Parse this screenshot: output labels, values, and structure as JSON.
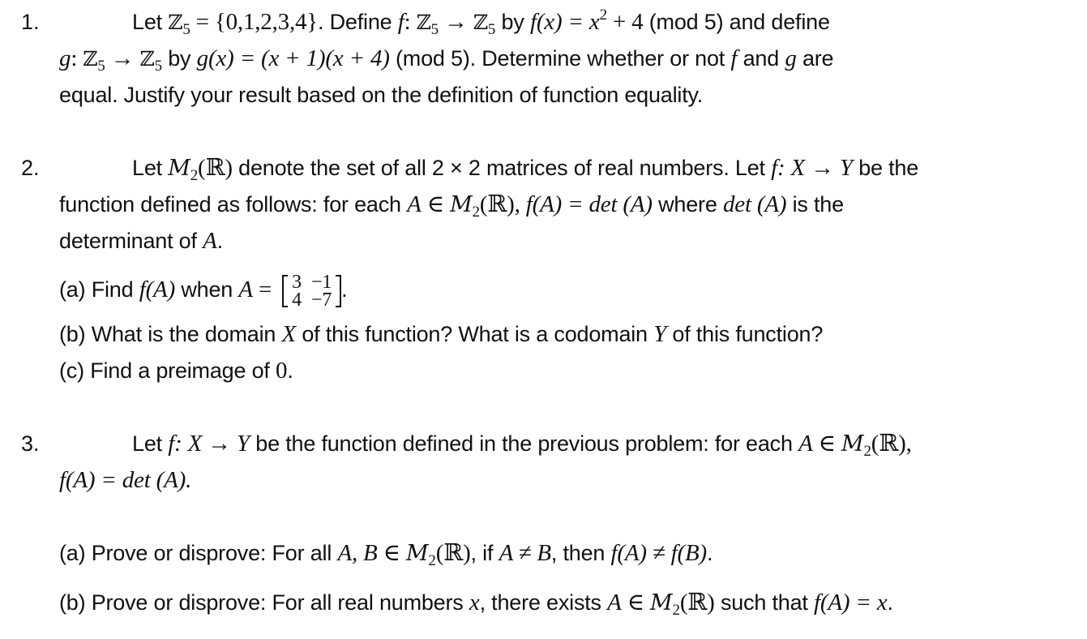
{
  "problems": [
    {
      "number": "1.",
      "z5": "ℤ",
      "sub5": "5",
      "set": " = {0,1,2,3,4}",
      "lines": {
        "l1_let": "Let ",
        "l1_define": ".  Define ",
        "l1_f": "f",
        "l1_colon": ": ",
        "l1_arrow": " → ",
        "l1_by": " by ",
        "l1_fx": "f",
        "l1_fx_rest": "(x) = x",
        "l1_sq": "2",
        "l1_plus4": " + 4",
        "l1_mod": " (mod 5) and define",
        "l2_g": "g",
        "l2_by": " by ",
        "l2_gx": "g",
        "l2_expr": "(x) = (x + 1)(x + 4)",
        "l2_mod": " (mod 5). Determine whether or not ",
        "l2_f": "f",
        "l2_and": " and ",
        "l2_g2": "g",
        "l2_are": " are",
        "l3": "equal.  Justify your result based on the definition of function equality."
      }
    },
    {
      "number": "2.",
      "lines": {
        "l1_let": "Let ",
        "l1_M": "M",
        "l1_sub": "2",
        "l1_R": "(ℝ)",
        "l1_text": " denote the set of all 2 × 2 matrices of real numbers. Let ",
        "l1_f": "f",
        "l1_map": ": X → Y",
        "l1_end": " be the",
        "l2_text": "function defined as follows: for each ",
        "l2_A": "A",
        "l2_in": " ∈ ",
        "l2_M": "M",
        "l2_sub": "2",
        "l2_R": "(ℝ), ",
        "l2_fA": "f",
        "l2_eq": "(A) = det (A)",
        "l2_where": " where ",
        "l2_det": "det (A)",
        "l2_isthe": " is the",
        "l3_text": "determinant of ",
        "l3_A": "A",
        "l3_dot": "."
      },
      "parts": [
        {
          "label": "(a)",
          "text_before": " Find ",
          "f": "f",
          "fA": "(A)",
          "when": " when ",
          "A": "A",
          "eq": " = ",
          "matrix": [
            [
              "3",
              "−1"
            ],
            [
              "4",
              "−7"
            ]
          ],
          "end": "."
        },
        {
          "label": "(b)",
          "text": " What is the domain ",
          "X": "X",
          "text2": " of this function?  What is a codomain ",
          "Y": "Y",
          "text3": " of this function?"
        },
        {
          "label": "(c)",
          "text": " Find a preimage of ",
          "zero": "0",
          "end": "."
        }
      ]
    },
    {
      "number": "3.",
      "lines": {
        "l1_let": "Let ",
        "l1_f": "f",
        "l1_map": ": X → Y",
        "l1_text": " be the function defined in the previous problem: for each ",
        "l1_A": "A",
        "l1_in": " ∈ ",
        "l1_M": "M",
        "l1_sub": "2",
        "l1_R": "(ℝ),",
        "l2_f": "f",
        "l2_eq": "(A) = det (A)."
      },
      "parts": [
        {
          "label": "(a)",
          "text": " Prove or disprove:  For all ",
          "AB": "A, B",
          "in": " ∈ ",
          "M": "M",
          "sub": "2",
          "R": "(ℝ)",
          "if": ", if ",
          "neq": "A ≠ B",
          "then": ", then ",
          "f1": "f",
          "fA": "(A) ≠ ",
          "f2": "f",
          "fB": "(B)",
          "end": "."
        },
        {
          "label": "(b)",
          "text": " Prove or disprove:  For all real numbers ",
          "x": "x",
          "exists": ", there exists  ",
          "A": "A",
          "in": " ∈ ",
          "M": "M",
          "sub": "2",
          "R": "(ℝ)",
          "such": " such that ",
          "f": "f",
          "fA": "(A) = x",
          "end": "."
        }
      ]
    }
  ]
}
